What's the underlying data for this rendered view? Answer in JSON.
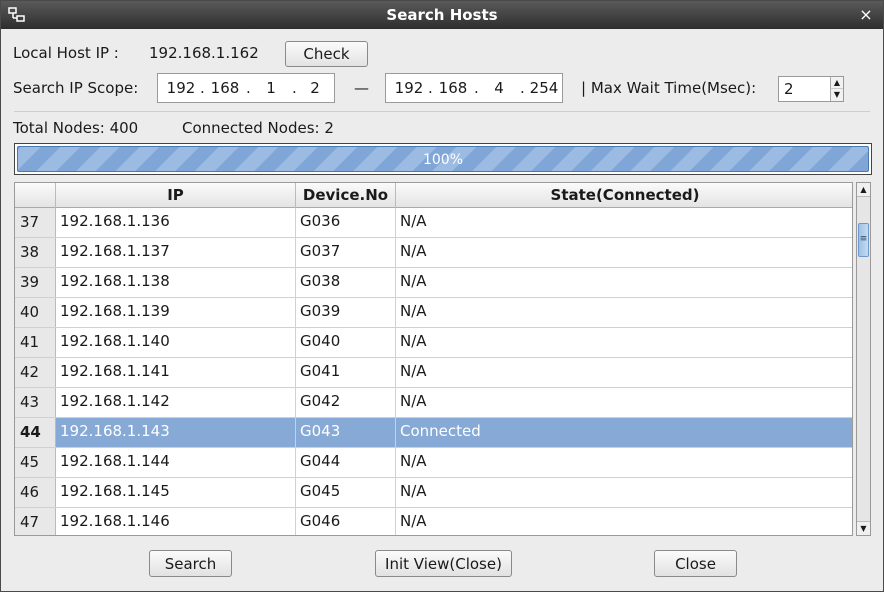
{
  "window": {
    "title": "Search Hosts",
    "close_glyph": "×",
    "menu_icon": "window-menu-icon"
  },
  "local_host": {
    "label": "Local Host IP :",
    "value": "192.168.1.162",
    "check_label": "Check"
  },
  "scope": {
    "label": "Search IP Scope:",
    "from": [
      "192",
      "168",
      "1",
      "2"
    ],
    "dash": "—",
    "to": [
      "192",
      "168",
      "4",
      "254"
    ],
    "max_wait_label": "| Max Wait Time(Msec):",
    "max_wait_value": "2"
  },
  "stats": {
    "total_label": "Total Nodes: 400",
    "connected_label": "Connected Nodes: 2"
  },
  "progress": {
    "text": "100%",
    "value": 1.0
  },
  "table": {
    "headers": [
      "",
      "IP",
      "Device.No",
      "State(Connected)"
    ],
    "rows": [
      {
        "num": "37",
        "ip": "192.168.1.136",
        "device": "G036",
        "state": "N/A"
      },
      {
        "num": "38",
        "ip": "192.168.1.137",
        "device": "G037",
        "state": "N/A"
      },
      {
        "num": "39",
        "ip": "192.168.1.138",
        "device": "G038",
        "state": "N/A"
      },
      {
        "num": "40",
        "ip": "192.168.1.139",
        "device": "G039",
        "state": "N/A"
      },
      {
        "num": "41",
        "ip": "192.168.1.140",
        "device": "G040",
        "state": "N/A"
      },
      {
        "num": "42",
        "ip": "192.168.1.141",
        "device": "G041",
        "state": "N/A"
      },
      {
        "num": "43",
        "ip": "192.168.1.142",
        "device": "G042",
        "state": "N/A"
      },
      {
        "num": "44",
        "ip": "192.168.1.143",
        "device": "G043",
        "state": "Connected",
        "selected": true
      },
      {
        "num": "45",
        "ip": "192.168.1.144",
        "device": "G044",
        "state": "N/A"
      },
      {
        "num": "46",
        "ip": "192.168.1.145",
        "device": "G045",
        "state": "N/A"
      },
      {
        "num": "47",
        "ip": "192.168.1.146",
        "device": "G046",
        "state": "N/A"
      }
    ]
  },
  "buttons": {
    "search": "Search",
    "init_view": "Init View(Close)",
    "close": "Close"
  },
  "colors": {
    "selection": "#86a9d6",
    "progress": "#7fa6d6",
    "titlebar": "#3a3a3a"
  }
}
